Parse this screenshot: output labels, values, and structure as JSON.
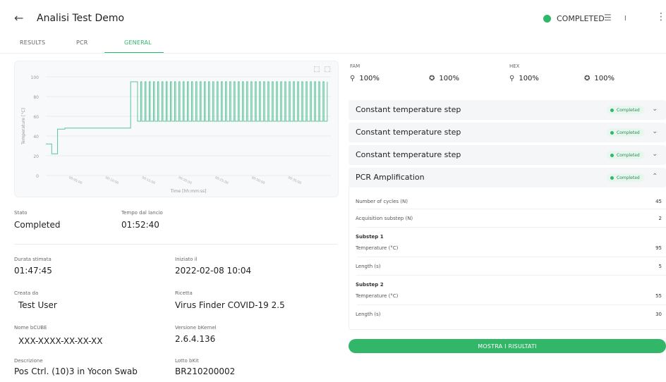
{
  "header": {
    "title": "Analisi Test Demo",
    "status": "COMPLETED",
    "icons": [
      "back-arrow-icon",
      "status-dot-icon",
      "toolbar-icon-a",
      "toolbar-icon-b",
      "more-vertical-icon"
    ]
  },
  "tabs": [
    {
      "label": "RESULTS"
    },
    {
      "label": "PCR"
    },
    {
      "label": "GENERAL"
    }
  ],
  "chart_data": {
    "type": "line",
    "xlabel": "Time [hh:mm:ss]",
    "ylabel": "Temperature [°C]",
    "ylim": [
      0,
      100
    ],
    "yticks": [
      0,
      20,
      40,
      60,
      80,
      100
    ],
    "xtick_labels": [
      "00:05:00",
      "00:10:00",
      "00:15:00",
      "00:20:00",
      "00:25:00",
      "00:30:00",
      "00:35:00"
    ],
    "grid": true,
    "series": [
      {
        "color": "#5cc59a",
        "x_minutes": [
          0.0,
          0.8,
          0.8,
          1.6,
          1.6,
          2.6,
          2.6,
          11.6,
          11.6,
          12.4
        ],
        "y": [
          32,
          32,
          22,
          22,
          47,
          47,
          48,
          48,
          95,
          95
        ],
        "cycles": 45,
        "cycle_high": 95,
        "cycle_low": 55,
        "cycle_start_minutes": 12.4,
        "cycle_period_minutes": 0.58
      }
    ]
  },
  "details": {
    "stato_label": "Stato",
    "stato_value": "Completed",
    "tempo_label": "Tempo dal lancio",
    "tempo_value": "01:52:40",
    "durata_label": "Durata stimata",
    "durata_value": "01:47:45",
    "iniziato_label": "Iniziato il",
    "iniziato_value": "2022-02-08 10:04",
    "creata_label": "Creata da",
    "creata_value": "Test User",
    "ricetta_label": "Ricetta",
    "ricetta_value": "Virus Finder COVID-19 2.5",
    "nome_label": "Nome bCUBE",
    "nome_value": "XXX-XXXX-XX-XX-XX",
    "versione_label": "Versione bKernel",
    "versione_value": "2.6.4.136",
    "descrizione_label": "Descrizione",
    "descrizione_value": "Pos Ctrl. (10)3 in Yocon Swab",
    "lotto_label": "Lotto bKit",
    "lotto_value": "BR210200002"
  },
  "channels": [
    {
      "name": "FAM",
      "a": "100%",
      "b": "100%"
    },
    {
      "name": "HEX",
      "a": "100%",
      "b": "100%"
    }
  ],
  "steps": [
    {
      "label": "Constant temperature step",
      "status": "Completed"
    },
    {
      "label": "Constant temperature step",
      "status": "Completed"
    },
    {
      "label": "Constant temperature step",
      "status": "Completed"
    },
    {
      "label": "PCR Amplification",
      "status": "Completed"
    }
  ],
  "pcr": {
    "cycles_label": "Number of cycles (N)",
    "cycles_value": "45",
    "acq_label": "Acquisition substep (N)",
    "acq_value": "2",
    "sub1_title": "Substep 1",
    "sub1_temp_label": "Temperature (°C)",
    "sub1_temp_value": "95",
    "sub1_len_label": "Length (s)",
    "sub1_len_value": "5",
    "sub2_title": "Substep 2",
    "sub2_temp_label": "Temperature (°C)",
    "sub2_temp_value": "55",
    "sub2_len_label": "Length (s)",
    "sub2_len_value": "30"
  },
  "cta_label": "MOSTRA I RISULTATI"
}
